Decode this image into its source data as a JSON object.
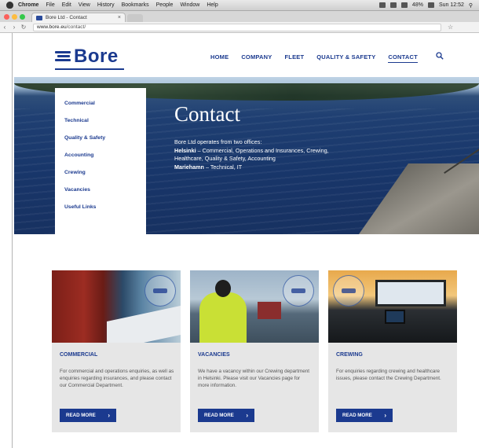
{
  "os_menu": {
    "items": [
      "Chrome",
      "File",
      "Edit",
      "View",
      "History",
      "Bookmarks",
      "People",
      "Window",
      "Help"
    ],
    "clock": "Sun 12:52",
    "battery": "48%"
  },
  "browser": {
    "tab_title": "Bore Ltd - Contact",
    "url_host": "www.bore.eu",
    "url_path": "/contact/"
  },
  "site": {
    "logo_text": "Bore",
    "nav": [
      "HOME",
      "COMPANY",
      "FLEET",
      "QUALITY & SAFETY",
      "CONTACT"
    ],
    "active_nav": "CONTACT"
  },
  "side_menu": [
    "Commercial",
    "Technical",
    "Quality & Safety",
    "Accounting",
    "Crewing",
    "Vacancies",
    "Useful Links"
  ],
  "hero": {
    "title": "Contact",
    "intro": "Bore Ltd operates from two offices:",
    "office1_name": "Helsinki",
    "office1_desc": " – Commercial, Operations and Insurances, Crewing, Healthcare, Quality & Safety, Accounting",
    "office2_name": "Mariehamn",
    "office2_desc": " – Technical, IT"
  },
  "cards": [
    {
      "title": "COMMERCIAL",
      "text": "For commercial and operations enquiries, as well as enquiries regarding insurances, and please contact our Commercial Department.",
      "button": "READ MORE"
    },
    {
      "title": "VACANCIES",
      "text": "We have a vacancy within our Crewing department in Helsinki. Please visit our Vacancies page for more information.",
      "button": "READ MORE"
    },
    {
      "title": "CREWING",
      "text": "For enquiries regarding crewing and healthcare issues, please contact the Crewing Department.",
      "button": "READ MORE"
    }
  ],
  "colors": {
    "brand_blue": "#1b3a8f",
    "card_bg": "#e6e6e6"
  }
}
